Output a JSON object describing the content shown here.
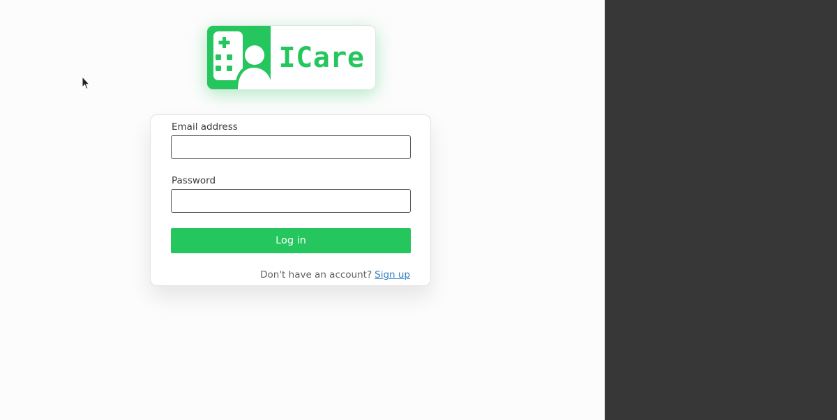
{
  "colors": {
    "brand_green": "#25c65e",
    "page_background": "#fcfcfc",
    "side_panel": "#373737",
    "link_blue": "#2f7fc4"
  },
  "logo": {
    "icon": "hospital-user-icon",
    "text": "ICare"
  },
  "login_form": {
    "email_label": "Email address",
    "email_value": "",
    "email_placeholder": "",
    "password_label": "Password",
    "password_value": "",
    "password_placeholder": "",
    "submit_label": "Log in",
    "signup_prompt": "Don't have an account?",
    "signup_link": "Sign up"
  },
  "cursor": {
    "icon": "mouse-pointer-icon"
  }
}
